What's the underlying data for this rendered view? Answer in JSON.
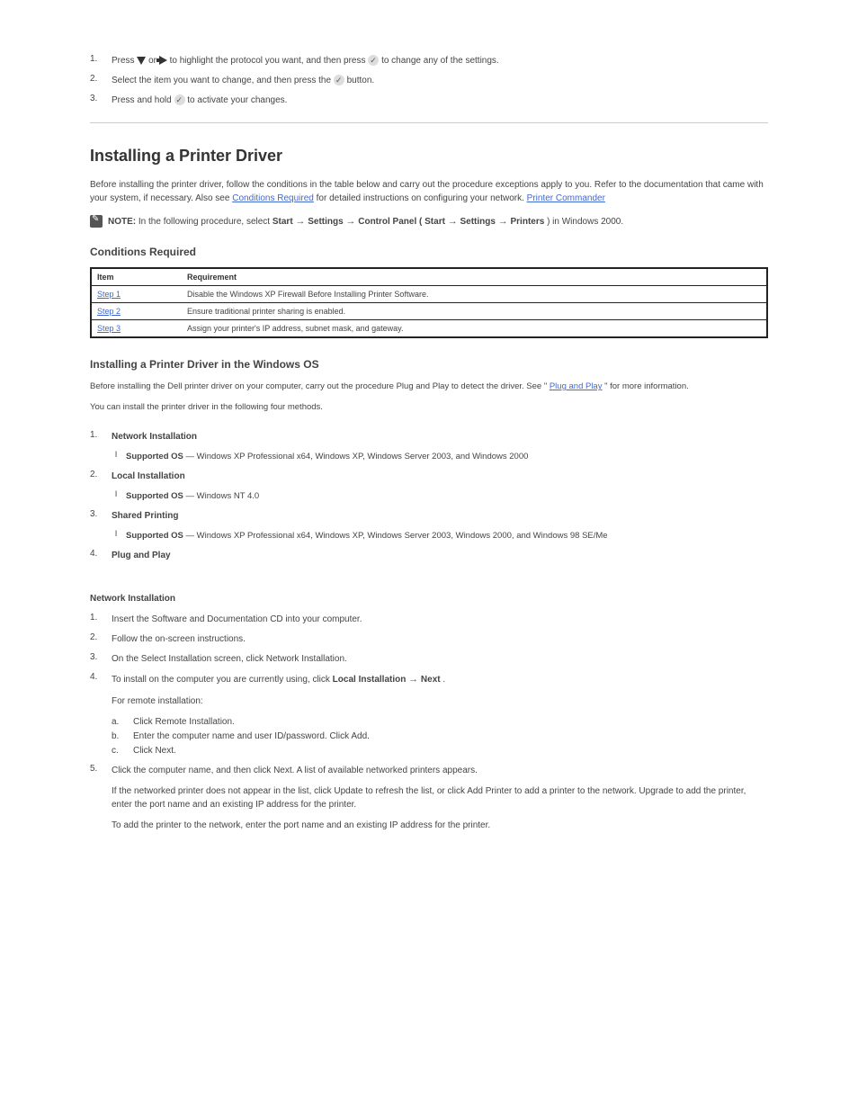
{
  "instr": {
    "s1_num": "1.",
    "s1_a": "Press ",
    "s1_b": " or ",
    "s1_c": " to highlight the protocol you want, and then press ",
    "s1_d": " to change any of the settings.",
    "s2_num": "2.",
    "s2_a": "Select the item you want to change, and then press the ",
    "s2_b": " button.",
    "s3_num": "3.",
    "s3_a": "Press and hold ",
    "s3_b": " to activate your changes."
  },
  "h1": "Installing a Printer Driver",
  "intro": {
    "a": "Before installing the printer driver, follow the conditions in the table below and carry out the procedure exceptions apply to you. Refer to the documentation that came with your system, if necessary. Also see ",
    "b": " for detailed instructions on configuring your network.",
    "link1": "Conditions Required",
    "link2": "Printer Commander"
  },
  "note": {
    "label": "NOTE:",
    "a": " In the following procedure, select ",
    "b": "Start ",
    "c": " Settings ",
    "d": " Control Panel (",
    "e": "Start ",
    "f": " Settings ",
    "g": " Printers",
    "h": ") in Windows 2000.",
    "arrow": "→"
  },
  "tablehead": "Conditions Required",
  "table": {
    "h_item": "Item",
    "h_requirement": "Requirement",
    "rows": [
      {
        "item_link": "Step 1",
        "req": "Disable the Windows XP Firewall Before Installing Printer Software."
      },
      {
        "item_link": "Step 2",
        "req": "Ensure traditional printer sharing is enabled."
      },
      {
        "item_link": "Step 3",
        "req": "Assign your printer's IP address, subnet mask, and gateway."
      }
    ]
  },
  "installing": {
    "h": "Installing a Printer Driver in the Windows OS",
    "p1a": "Before installing the Dell printer driver on your computer, carry out the procedure Plug and Play to detect the driver. See \"",
    "p1_link": "Plug and Play",
    "p1b": "\" for more information.",
    "p2": "You can install the printer driver in the following four methods."
  },
  "methods": {
    "m1": {
      "label": "1.",
      "title": "Network Installation",
      "sub_label": "Supported OS",
      "sub_text": " — Windows XP Professional x64, Windows XP, Windows Server 2003, and Windows 2000"
    },
    "m2": {
      "label": "2.",
      "title": "Local Installation",
      "sub_label": "Supported OS",
      "sub_text": " — Windows NT 4.0"
    },
    "m3": {
      "label": "3.",
      "title": "Shared Printing",
      "sub_label": "Supported OS",
      "sub_text": " — Windows XP Professional x64, Windows XP, Windows Server 2003, Windows 2000, and Windows 98 SE/Me"
    },
    "m4": {
      "label": "4.",
      "title": "Plug and Play",
      "sub_label": "",
      "sub_text": ""
    }
  },
  "network": {
    "h": "Network Installation",
    "s1_num": "1.",
    "s1": "Insert the Software and Documentation CD into your computer.",
    "s2_num": "2.",
    "s2": "Follow the on-screen instructions.",
    "s3_num": "3.",
    "s3": "On the Select Installation screen, click Network Installation.",
    "s4_num": "4.",
    "s4_a": "To install on the computer you are currently using, click ",
    "s4_b": "Local Installation ",
    "arrow": "→",
    "s4_c": " Next",
    "s4_d": ".",
    "s4_p2": "For remote installation:",
    "s4_a_lbl": "a.",
    "s4_a_txt": "Click Remote Installation.",
    "s4_b_lbl": "b.",
    "s4_b_txt": "Enter the computer name and user ID/password. Click Add.",
    "s4_c_lbl": "c.",
    "s4_c_txt": "Click Next.",
    "s5_num": "5.",
    "s5a": "Click the computer name, and then click Next. A list of available networked printers appears.",
    "s5b": "If the networked printer does not appear in the list, click Update to refresh the list, or click Add Printer to add a printer to the network. Upgrade to add the printer, enter the port name and an existing IP address for the printer.",
    "s5c": "To add the printer to the network, enter the port name and an existing IP address for the printer."
  }
}
